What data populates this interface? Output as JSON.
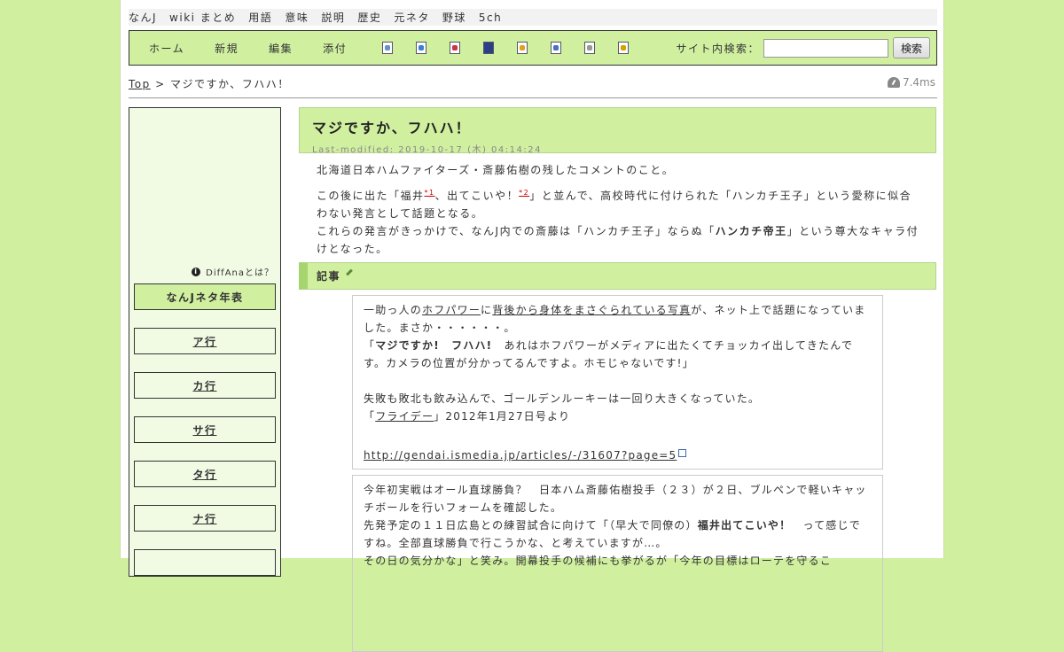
{
  "top_nav": [
    "なんJ",
    "wiki まとめ",
    "用語",
    "意味",
    "説明",
    "歴史",
    "元ネタ",
    "野球",
    "5ch"
  ],
  "toolbar": {
    "buttons": [
      "ホーム",
      "新規",
      "編集",
      "添付"
    ],
    "icons": [
      "new-page-icon",
      "search-page-icon",
      "delete-icon",
      "save-icon",
      "lock-icon",
      "copy-icon",
      "list-icon",
      "help-icon"
    ],
    "search_label": "サイト内検索：",
    "search_value": "",
    "search_button": "検索"
  },
  "breadcrumb": {
    "root": "Top",
    "sep": ">",
    "current": "マジですか、フハハ！"
  },
  "timing": "7.4ms",
  "sidebar": {
    "diffana": "DiffAnaとは？",
    "items": [
      "なんJネタ年表",
      "ア行",
      "カ行",
      "サ行",
      "タ行",
      "ナ行"
    ]
  },
  "page": {
    "title": "マジですか、フハハ！",
    "last_modified": "Last-modified: 2019-10-17 (木) 04:14:24",
    "intro1": "北海道日本ハムファイターズ・斎藤佑樹の残したコメントのこと。",
    "intro2a": "この後に出た「福井",
    "fn1": "*1",
    "intro2b": "、出てこいや！",
    "fn2": "*2",
    "intro2c": "」と並んで、高校時代に付けられた「ハンカチ王子」という愛称に似合わない発言として話題となる。",
    "intro3a": "これらの発言がきっかけで、なんJ内での斎藤は「ハンカチ王子」ならぬ「",
    "intro3b": "ハンカチ帝王",
    "intro3c": "」という尊大なキャラ付けとなった。",
    "section_title": "記事",
    "quote1": {
      "line1a": "一助っ人の",
      "link1": "ホフパワー",
      "line1b": "に",
      "link2": "背後から身体をまさぐられている写真",
      "line1c": "が、ネット上で話題になっていました。まさか・・・・・・。",
      "line2a": "「",
      "bold1": "マジですか!　フハハ!",
      "line2b": "　あれはホフパワーがメディアに出たくてチョッカイ出してきたんです。カメラの位置が分かってるんですよ。ホモじゃないです!」",
      "line3": "失敗も敗北も飲み込んで、ゴールデンルーキーは一回り大きくなっていた。",
      "line4a": "「",
      "link3": "フライデー",
      "line4b": "」2012年1月27日号より",
      "url": "http://gendai.ismedia.jp/articles/-/31607?page=5"
    },
    "quote2": {
      "line1": "今年初実戦はオール直球勝負？　日本ハム斎藤佑樹投手（２３）が２日、ブルペンで軽いキャッチボールを行いフォームを確認した。",
      "line2a": "先発予定の１１日広島との練習試合に向けて「（早大で同僚の）",
      "bold1": "福井出てこいや！",
      "line2b": "　って感じですね。全部直球勝負で行こうかな、と考えていますが…。",
      "line3": "その日の気分かな」と笑み。開幕投手の候補にも挙がるが「今年の目標はローテを守るこ"
    }
  }
}
